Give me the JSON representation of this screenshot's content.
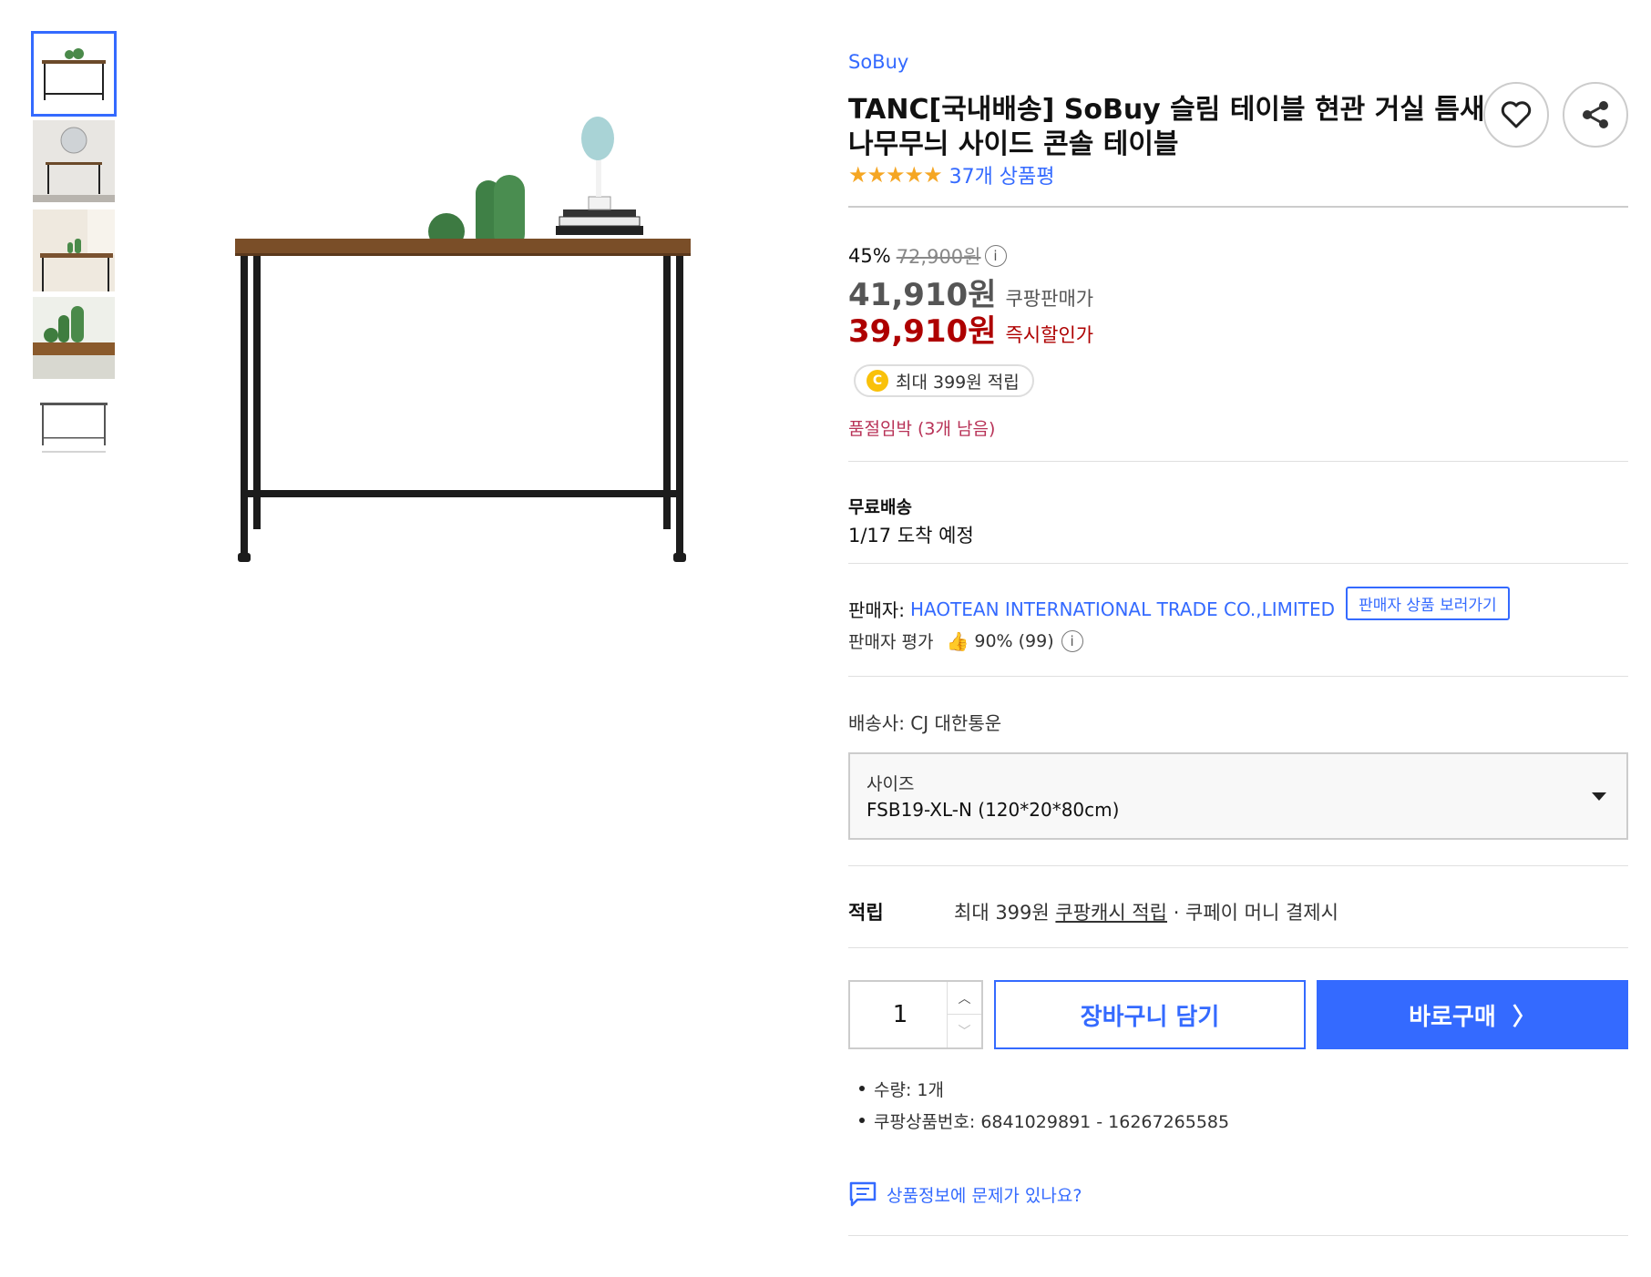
{
  "thumbnails": [
    {
      "name": "thumb-1",
      "active": true
    },
    {
      "name": "thumb-2",
      "active": false
    },
    {
      "name": "thumb-3",
      "active": false
    },
    {
      "name": "thumb-4",
      "active": false
    },
    {
      "name": "thumb-5",
      "active": false
    }
  ],
  "product": {
    "brand": "SoBuy",
    "title": "TANC[국내배송] SoBuy 슬림 테이블 현관 거실 틈새 나무무늬 사이드 콘솔 테이블",
    "stars": "★★★★★",
    "review_count": "37개 상품평"
  },
  "price": {
    "discount_pct": "45%",
    "original": "72,900원",
    "info_icon": "i",
    "coupang_price": "41,910원",
    "coupang_price_label": "쿠팡판매가",
    "instant_price": "39,910원",
    "instant_price_label": "즉시할인가",
    "cash_coin": "C",
    "cash_reward": "최대 399원 적립",
    "stock_warning": "품절임박 (3개 남음)"
  },
  "shipping": {
    "title": "무료배송",
    "date": "1/17 도착 예정",
    "carrier": "배송사: CJ 대한통운"
  },
  "seller": {
    "label": "판매자:",
    "name": "HAOTEAN INTERNATIONAL TRADE CO.,LIMITED",
    "link_label": "판매자 상품 보러가기",
    "rating_label": "판매자 평가",
    "rating_value": "90% (99)",
    "thumb_icon": "👍"
  },
  "option": {
    "label": "사이즈",
    "value": "FSB19-XL-N (120*20*80cm)"
  },
  "reward": {
    "label": "적립",
    "prefix": "최대 399원 ",
    "link": "쿠팡캐시 적립",
    "suffix": " · 쿠페이 머니 결제시"
  },
  "purchase": {
    "quantity": "1",
    "up_icon": "︿",
    "down_icon": "﹀",
    "cart_label": "장바구니 담기",
    "buy_label": "바로구매",
    "buy_chevron": "〉"
  },
  "notes": [
    "수량: 1개",
    "쿠팡상품번호: 6841029891 - 16267265585"
  ],
  "report_label": "상품정보에 문제가 있나요?",
  "colors": {
    "accent": "#346aff",
    "sale_red": "#ae0000",
    "stock_red": "#b83257"
  }
}
